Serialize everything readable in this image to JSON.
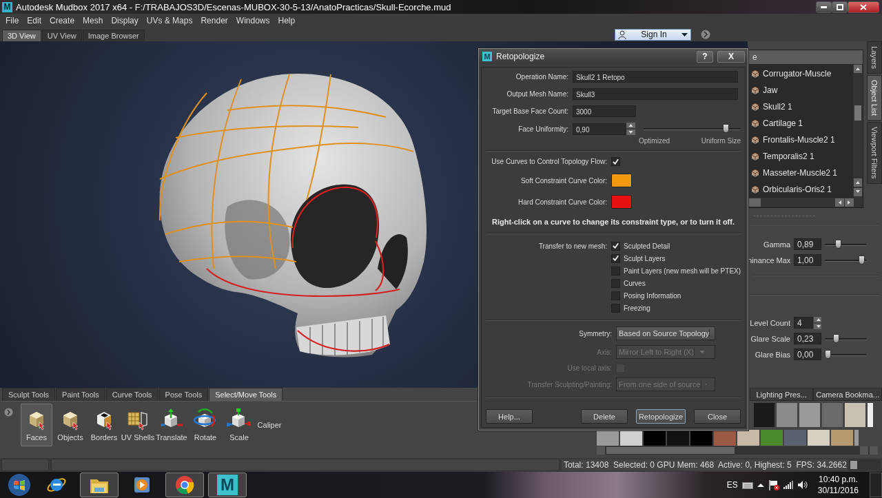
{
  "window": {
    "icon_letter": "M",
    "title": "Autodesk Mudbox 2017 x64 - F:/TRABAJOS3D/Escenas-MUBOX-30-5-13/AnatoPracticas/Skull-Ecorche.mud"
  },
  "menu": [
    "File",
    "Edit",
    "Create",
    "Mesh",
    "Display",
    "UVs & Maps",
    "Render",
    "Windows",
    "Help"
  ],
  "view_tabs": [
    {
      "label": "3D View",
      "selected": true
    },
    {
      "label": "UV View",
      "selected": false
    },
    {
      "label": "Image Browser",
      "selected": false
    }
  ],
  "sign_in": {
    "label": "Sign In"
  },
  "side_tabs": [
    {
      "label": "Layers",
      "selected": false
    },
    {
      "label": "Object List",
      "selected": true
    },
    {
      "label": "Viewport Filters",
      "selected": false
    }
  ],
  "object_list": {
    "header": "e",
    "items": [
      "Corrugator-Muscle",
      "Jaw",
      "Skull2 1",
      "Cartilage 1",
      "Frontalis-Muscle2 1",
      "Temporalis2 1",
      "Masseter-Muscle2 1",
      "Orbicularis-Oris2 1"
    ]
  },
  "display_properties": [
    {
      "kind": "slider",
      "label": "Gamma",
      "value": "0,89",
      "level": 0.3
    },
    {
      "kind": "slider",
      "label": "ninance Max",
      "value": "1,00",
      "level": 0.97
    }
  ],
  "glare_properties": [
    {
      "kind": "spinner",
      "label": "Level Count",
      "value": "4"
    },
    {
      "kind": "slider",
      "label": "Glare Scale",
      "value": "0,23",
      "level": 0.24
    },
    {
      "kind": "slider",
      "label": "Glare Bias",
      "value": "0,00",
      "level": 0.0
    }
  ],
  "tool_tabs": [
    {
      "label": "Sculpt Tools",
      "selected": false
    },
    {
      "label": "Paint Tools",
      "selected": false
    },
    {
      "label": "Curve Tools",
      "selected": false
    },
    {
      "label": "Pose Tools",
      "selected": false
    },
    {
      "label": "Select/Move Tools",
      "selected": true
    }
  ],
  "tools": [
    {
      "kind": "faces",
      "label": "Faces",
      "selected": true
    },
    {
      "kind": "objects",
      "label": "Objects",
      "selected": false
    },
    {
      "kind": "borders",
      "label": "Borders",
      "selected": false
    },
    {
      "kind": "shells",
      "label": "UV Shells",
      "selected": false
    },
    {
      "kind": "translate",
      "label": "Translate",
      "selected": false
    },
    {
      "kind": "rotate",
      "label": "Rotate",
      "selected": false
    },
    {
      "kind": "scale",
      "label": "Scale",
      "selected": false
    },
    {
      "kind": "caliper",
      "label": "Caliper",
      "selected": false
    }
  ],
  "library_tabs": [
    {
      "label": "Lighting Pres...",
      "selected": false
    },
    {
      "label": "Camera Bookma...",
      "selected": false
    }
  ],
  "status_bar": "Total: 13408  Selected: 0 GPU Mem: 468  Active: 0, Highest: 5  FPS: 34.2662",
  "taskbar": {
    "apps": [
      {
        "kind": "browser",
        "running": false
      },
      {
        "kind": "folder",
        "running": true
      },
      {
        "kind": "media",
        "running": false
      },
      {
        "kind": "chrome",
        "running": true
      },
      {
        "kind": "mudbox",
        "running": true,
        "letter": "M"
      }
    ],
    "language": "ES",
    "time": "10:40 p.m.",
    "date": "30/11/2016"
  },
  "dialog": {
    "icon_letter": "M",
    "title": "Retopologize",
    "help_button": "?",
    "close_button": "X",
    "fields": [
      {
        "label": "Operation Name:",
        "value": "Skull2 1 Retopo"
      },
      {
        "label": "Output Mesh Name:",
        "value": "Skull3"
      },
      {
        "label": "Target Base Face Count:",
        "value": "3000"
      }
    ],
    "face_uniformity": {
      "label": "Face Uniformity:",
      "value": "0,90",
      "level": 0.88,
      "min_label": "Optimized",
      "max_label": "Uniform Size"
    },
    "use_curves": {
      "label": "Use Curves to Control Topology Flow:",
      "checked": true
    },
    "curve_colors": [
      {
        "label": "Soft Constraint Curve Color:",
        "color": "#f39a0c"
      },
      {
        "label": "Hard Constraint Curve Color:",
        "color": "#ea1111"
      }
    ],
    "note": "Right-click on a curve to change its constraint type, or to turn it off.",
    "transfer": {
      "label": "Transfer to new mesh:",
      "options": [
        {
          "label": "Sculpted Detail",
          "checked": true
        },
        {
          "label": "Sculpt Layers",
          "checked": true
        },
        {
          "label": "Paint Layers (new mesh will be PTEX)",
          "checked": false
        },
        {
          "label": "Curves",
          "checked": false
        },
        {
          "label": "Posing Information",
          "checked": false
        },
        {
          "label": "Freezing",
          "checked": false
        }
      ]
    },
    "symmetry_rows": [
      {
        "kind": "dropdown",
        "label": "Symmetry:",
        "value": "Based on Source Topology",
        "disabled": false
      },
      {
        "kind": "dropdown",
        "label": "Axis:",
        "value": "Mirror Left to Right (X)",
        "disabled": true
      },
      {
        "kind": "checkbox",
        "label": "Use local axis:",
        "checked": false,
        "disabled": true
      },
      {
        "kind": "dropdown",
        "label": "Transfer Sculpting/Painting:",
        "value": "From one side of source",
        "disabled": true
      }
    ],
    "buttons": [
      {
        "label": "Help...",
        "default": false
      },
      {
        "label": "Delete",
        "default": false
      },
      {
        "label": "Retopologize",
        "default": true
      },
      {
        "label": "Close",
        "default": false
      }
    ]
  }
}
